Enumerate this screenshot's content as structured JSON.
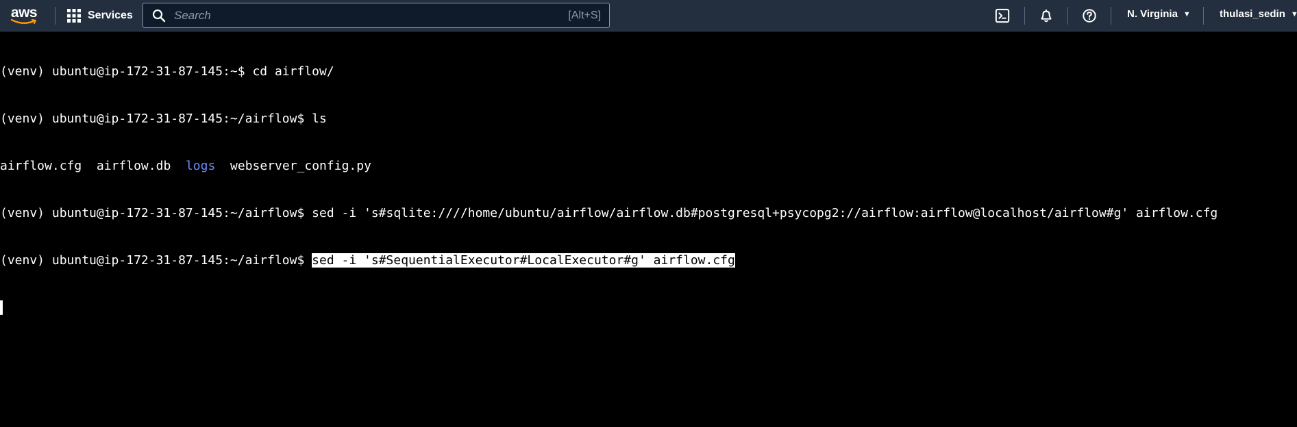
{
  "topbar": {
    "logo_text": "aws",
    "services_label": "Services",
    "search_placeholder": "Search",
    "search_shortcut": "[Alt+S]",
    "region_label": "N. Virginia",
    "user_label": "thulasi_sedin",
    "icons": [
      "aws-logo",
      "grid-icon",
      "search-icon",
      "cloudshell-icon",
      "bell-icon",
      "help-icon",
      "caret-down-icon"
    ]
  },
  "terminal": {
    "line1": "(venv) ubuntu@ip-172-31-87-145:~$ cd airflow/",
    "line2": "(venv) ubuntu@ip-172-31-87-145:~/airflow$ ls",
    "ls_file1": "airflow.cfg",
    "ls_file2": "airflow.db",
    "ls_dir": "logs",
    "ls_file3": "webserver_config.py",
    "line4": "(venv) ubuntu@ip-172-31-87-145:~/airflow$ sed -i 's#sqlite:////home/ubuntu/airflow/airflow.db#postgresql+psycopg2://airflow:airflow@localhost/airflow#g' airflow.cfg",
    "line5_prompt": "(venv) ubuntu@ip-172-31-87-145:~/airflow$ ",
    "line5_selected": "sed -i 's#SequentialExecutor#LocalExecutor#g' airflow.cfg"
  },
  "colors": {
    "topbar_bg": "#232f3e",
    "terminal_bg": "#000000",
    "terminal_fg": "#ffffff",
    "directory_color": "#6c8cff"
  }
}
